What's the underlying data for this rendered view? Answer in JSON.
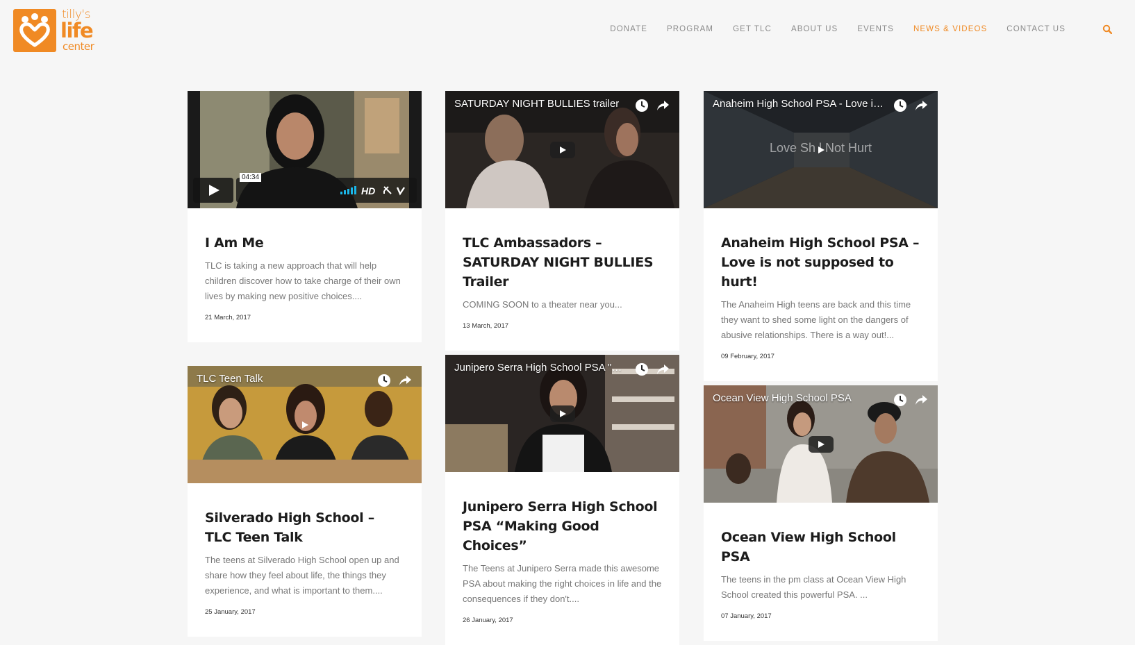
{
  "brand": {
    "logo_line1": "tilly's",
    "logo_line2": "life",
    "logo_line3": "center",
    "accent": "#f08a24"
  },
  "nav": {
    "items": [
      {
        "label": "DONATE"
      },
      {
        "label": "PROGRAM"
      },
      {
        "label": "GET TLC"
      },
      {
        "label": "ABOUT US"
      },
      {
        "label": "EVENTS"
      },
      {
        "label": "NEWS & VIDEOS",
        "active": true
      },
      {
        "label": "CONTACT US"
      }
    ],
    "search_icon": "search-icon"
  },
  "posts": [
    {
      "video_provider": "vimeo",
      "video_time": "04:34",
      "title": "I Am Me",
      "excerpt": "TLC is taking a new approach that will help children discover how to take charge of their own lives by making new positive choices....",
      "date": "21 March, 2017"
    },
    {
      "video_provider": "youtube",
      "video_title": "SATURDAY NIGHT BULLIES trailer",
      "title": "TLC Ambassadors – SATURDAY NIGHT BULLIES Trailer",
      "excerpt": "COMING SOON to a theater near you...",
      "date": "13 March, 2017"
    },
    {
      "video_provider": "youtube",
      "video_title": "Anaheim High School PSA - Love is ...",
      "video_overlay": "Love Sh     l Not Hurt",
      "title": "Anaheim High School PSA – Love is not supposed to hurt!",
      "excerpt": "The Anaheim High teens are back and this time they want to shed some light on the dangers of abusive relationships. There is a way out!...",
      "date": "09 February, 2017"
    },
    {
      "video_provider": "youtube",
      "video_title": "TLC Teen Talk",
      "title": "Silverado High School – TLC Teen Talk",
      "excerpt": "The teens at Silverado High School open up and share how they feel about life, the things they experience, and what is important to them....",
      "date": "25 January, 2017"
    },
    {
      "video_provider": "youtube",
      "video_title": "Junipero Serra High School PSA \"M...",
      "title": "Junipero Serra High School PSA “Making Good Choices”",
      "excerpt": "The Teens at Junipero Serra made this awesome PSA about making the right choices in life and the consequences if they don't....",
      "date": "26 January, 2017"
    },
    {
      "video_provider": "youtube",
      "video_title": "Ocean View High School PSA",
      "title": "Ocean View High School PSA",
      "excerpt": "The teens in the pm class at Ocean View High School created this powerful PSA. ...",
      "date": "07 January, 2017"
    }
  ]
}
